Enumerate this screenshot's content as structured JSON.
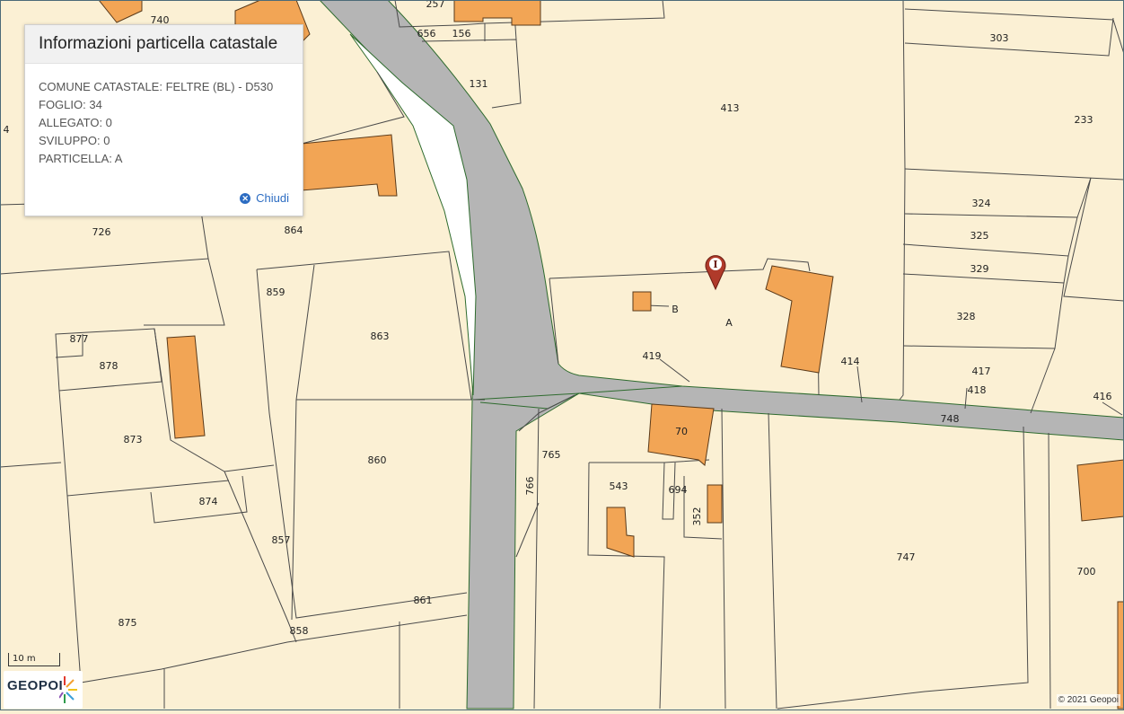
{
  "popup": {
    "title": "Informazioni particella catastale",
    "lines": [
      "COMUNE CATASTALE: FELTRE (BL) - D530",
      "FOGLIO: 34",
      "ALLEGATO: 0",
      "SVILUPPO: 0",
      "PARTICELLA: A"
    ],
    "close_label": "Chiudi",
    "close_icon": "close-circle-icon"
  },
  "map": {
    "marker_letter": "I",
    "marker_icon": "map-pin-icon",
    "parcel_labels": [
      "740",
      "257",
      "656",
      "156",
      "303",
      "131",
      "413",
      "233",
      "4",
      "726",
      "864",
      "324",
      "325",
      "859",
      "329",
      "B",
      "A",
      "863",
      "877",
      "878",
      "328",
      "419",
      "414",
      "417",
      "418",
      "416",
      "748",
      "70",
      "873",
      "860",
      "765",
      "766",
      "543",
      "694",
      "352",
      "874",
      "857",
      "747",
      "700",
      "875",
      "861",
      "858"
    ],
    "colors": {
      "parcel_fill": "#fbf0d4",
      "building_fill": "#f2a555",
      "road_fill": "#b5b5b5",
      "parcel_line": "#4a4a4a",
      "road_edge": "#2e6b2e"
    }
  },
  "scalebar": {
    "label": "10 m"
  },
  "logo": {
    "text": "GEOPOI"
  },
  "copyright": "© 2021 Geopoi"
}
